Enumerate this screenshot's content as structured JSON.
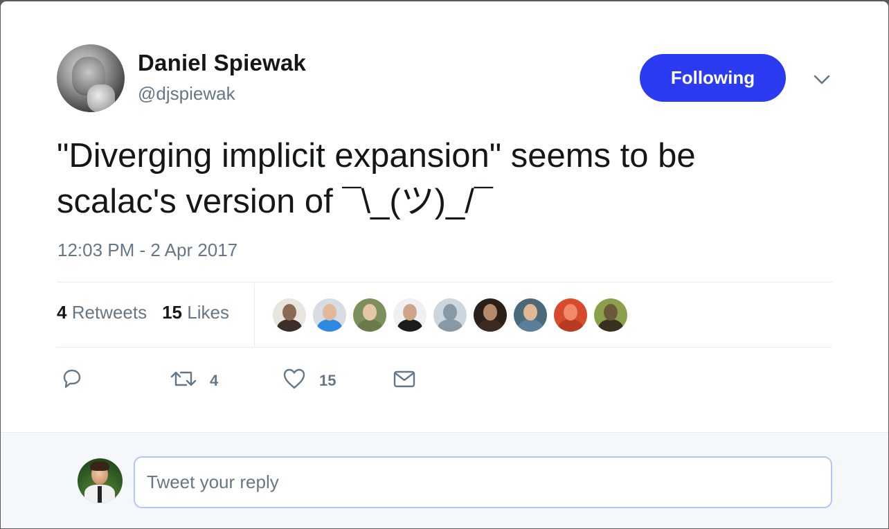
{
  "author": {
    "name": "Daniel Spiewak",
    "handle": "@djspiewak"
  },
  "follow_button": {
    "label": "Following",
    "color": "#2b3bf2"
  },
  "tweet": {
    "line1": "\"Diverging implicit expansion\" seems to be",
    "line2": "scalac's version of ¯\\_(ツ)_/¯",
    "timestamp": "12:03 PM - 2 Apr 2017"
  },
  "stats": {
    "retweets_count": "4",
    "retweets_label": "Retweets",
    "likes_count": "15",
    "likes_label": "Likes"
  },
  "likers": [
    {
      "name": "liker-avatar-1",
      "bg": "#e8e4de",
      "skin": "#8a6a52",
      "body": "#3b2f27"
    },
    {
      "name": "liker-avatar-2",
      "bg": "#d7dde3",
      "skin": "#e2b89a",
      "body": "#2c8be0"
    },
    {
      "name": "liker-avatar-3",
      "bg": "#7d8f5a",
      "skin": "#e5c7a8",
      "body": "#6b7a4a"
    },
    {
      "name": "liker-avatar-4",
      "bg": "#f0f0f0",
      "skin": "#cfa58a",
      "body": "#1c1c1c"
    },
    {
      "name": "liker-avatar-5",
      "bg": "#ccd6dd",
      "skin": "#8899a6",
      "body": "#8899a6"
    },
    {
      "name": "liker-avatar-6",
      "bg": "#2b2019",
      "skin": "#b58a6a",
      "body": "#3a2a20"
    },
    {
      "name": "liker-avatar-7",
      "bg": "#4a6a7a",
      "skin": "#e0b896",
      "body": "#5a7f9a"
    },
    {
      "name": "liker-avatar-8",
      "bg": "#d84a2e",
      "skin": "#f08a6a",
      "body": "#b83a22"
    },
    {
      "name": "liker-avatar-9",
      "bg": "#8aa04a",
      "skin": "#6a5a3a",
      "body": "#3a3020"
    }
  ],
  "actions": {
    "reply_count": "",
    "retweet_count": "4",
    "like_count": "15"
  },
  "reply_box": {
    "placeholder": "Tweet your reply"
  }
}
